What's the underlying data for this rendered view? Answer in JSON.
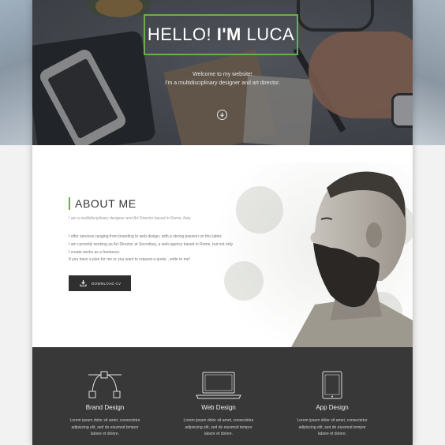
{
  "hero": {
    "title_part1": "HELLO!",
    "title_part2": "I'M",
    "title_part3": "LUCA",
    "subtitle_line1": "Welcome to my website!",
    "subtitle_line2": "I'm a multidisciplinary designer and art director."
  },
  "about": {
    "title": "ABOUT ME",
    "tagline": "I am a multidisciplinary designer and Art Director based in Rome, Italy.",
    "paragraph_lines": [
      "I offer services ranging from branding to web design, with a strong passion on this latter.",
      "I am currently working as Art Director at Secretkey, a web agency based in Rome, but not only.",
      "I create works as a freelance.",
      "If you have a plan for me or you want to request a quote , write to me!"
    ],
    "download_button": "DOWNLOAD CV"
  },
  "services": [
    {
      "title": "Brand Design",
      "icon": "vector-pen-icon",
      "desc_lines": [
        "Lorem ipsum dolor sit amet, consectetur",
        "adipiscing elit, sed do eiusmod tempor",
        "labore et dolore."
      ]
    },
    {
      "title": "Web Design",
      "icon": "laptop-icon",
      "desc_lines": [
        "Lorem ipsum dolor sit amet, consectetur",
        "adipiscing elit, sed do eiusmod tempor",
        "labore et dolore."
      ]
    },
    {
      "title": "App Design",
      "icon": "tablet-icon",
      "desc_lines": [
        "Lorem ipsum dolor sit amet, consectetur",
        "adipiscing elit, sed do eiusmod tempor",
        "labore et dolore."
      ]
    }
  ],
  "colors": {
    "accent": "#6aae4f",
    "services_bg": "#383838",
    "button_bg": "#2f2f2f"
  }
}
